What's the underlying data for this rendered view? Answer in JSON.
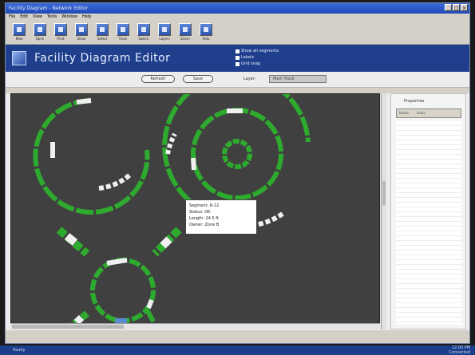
{
  "window": {
    "title": "Facility Diagram - Network Editor"
  },
  "menu": [
    "File",
    "Edit",
    "View",
    "Tools",
    "Window",
    "Help"
  ],
  "toolbar": [
    {
      "label": "New",
      "icon": "new-icon"
    },
    {
      "label": "Open",
      "icon": "open-icon"
    },
    {
      "label": "Print",
      "icon": "print-icon"
    },
    {
      "label": "Draw",
      "icon": "draw-icon"
    },
    {
      "label": "Select",
      "icon": "select-icon"
    },
    {
      "label": "Track",
      "icon": "track-icon"
    },
    {
      "label": "Switch",
      "icon": "switch-icon"
    },
    {
      "label": "Layers",
      "icon": "layers-icon"
    },
    {
      "label": "Zoom",
      "icon": "zoom-icon"
    },
    {
      "label": "Help",
      "icon": "help-icon"
    }
  ],
  "header": {
    "title": "Facility Diagram Editor",
    "options": [
      "Show all segments",
      "Labels",
      "Grid snap"
    ]
  },
  "controls": {
    "btn1": "Refresh",
    "btn2": "Save",
    "select_label": "Layer:",
    "select_value": "Main Track"
  },
  "tooltip": {
    "lines": [
      "Segment: R-12",
      "Status: OK",
      "Length: 24.5 ft",
      "Owner: Zone B"
    ]
  },
  "sidepanel": {
    "title": "Properties",
    "row": [
      "Name",
      "Value"
    ]
  },
  "status": {
    "left": "Ready",
    "right1": "12:00 PM",
    "right2": "Connected"
  },
  "colors": {
    "track_green": "#2eab2e",
    "track_white": "#f0f0f0",
    "canvas_bg": "#404040",
    "header_bg": "#1f3f8c"
  }
}
